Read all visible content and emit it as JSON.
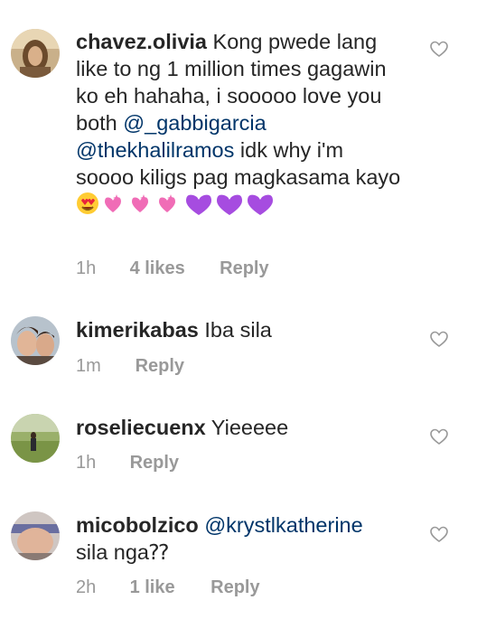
{
  "comments": [
    {
      "username": "chavez.olivia",
      "text_1": "Kong pwede lang like to ng 1 million times gagawin ko eh hahaha, i sooooo love you both",
      "mention_1": "@_gabbigarcia",
      "mention_2": "@thekhalilramos",
      "text_2": "idk why i'm soooo kiligs pag magkasama kayo",
      "time": "1h",
      "likes": "4 likes",
      "reply": "Reply"
    },
    {
      "username": "kimerikabas",
      "text": "Iba sila",
      "time": "1m",
      "reply": "Reply"
    },
    {
      "username": "roseliecuenx",
      "text": "Yieeeee",
      "time": "1h",
      "reply": "Reply"
    },
    {
      "username": "micobolzico",
      "mention": "@krystlkatherine",
      "text": "sila nga⁇",
      "time": "2h",
      "likes": "1 like",
      "reply": "Reply"
    }
  ],
  "icons": {
    "like": "heart-outline-icon",
    "emoji_heart_eyes": "heart-eyes-emoji",
    "emoji_sparkling": "sparkling-heart-emoji",
    "emoji_purple": "purple-heart-emoji"
  },
  "colors": {
    "text": "#262626",
    "muted": "#999999",
    "mention": "#003569",
    "pink_heart": "#f06cb6",
    "purple_heart": "#a64ce0"
  }
}
